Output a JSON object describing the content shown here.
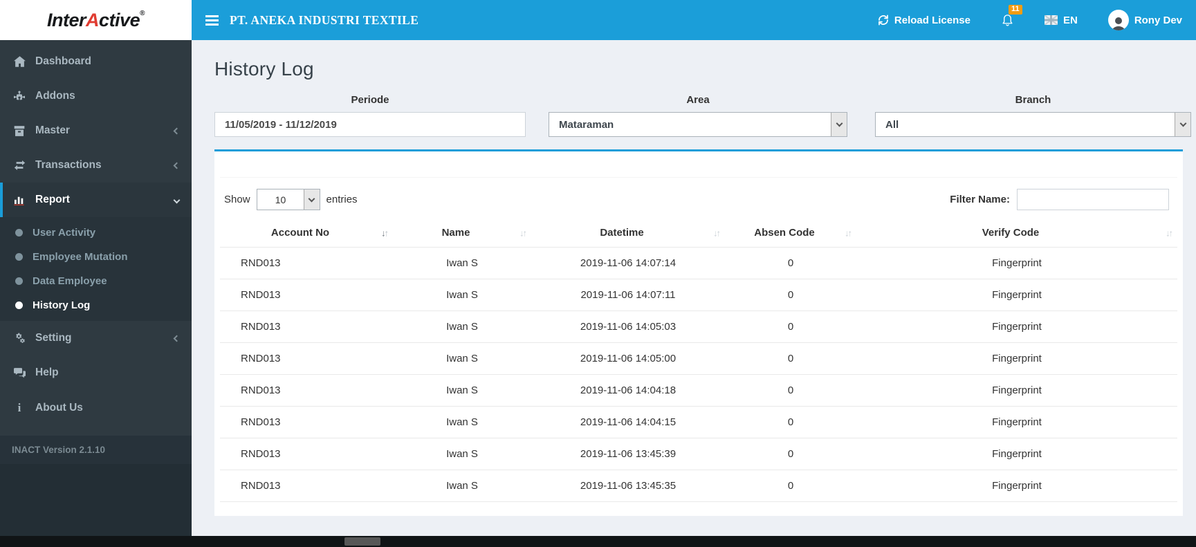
{
  "brand": {
    "part1": "Inter",
    "part2": "A",
    "part3": "ctive",
    "reg": "®"
  },
  "header": {
    "company": "PT. ANEKA INDUSTRI TEXTILE",
    "reload_label": "Reload License",
    "notification_count": "11",
    "language": "EN",
    "user_name": "Rony Dev"
  },
  "sidebar": {
    "items": [
      {
        "label": "Dashboard"
      },
      {
        "label": "Addons"
      },
      {
        "label": "Master"
      },
      {
        "label": "Transactions"
      },
      {
        "label": "Report"
      },
      {
        "label": "Setting"
      },
      {
        "label": "Help"
      },
      {
        "label": "About Us"
      }
    ],
    "submenu": [
      {
        "label": "User Activity"
      },
      {
        "label": "Employee Mutation"
      },
      {
        "label": "Data Employee"
      },
      {
        "label": "History Log"
      }
    ],
    "version": "INACT Version 2.1.10"
  },
  "page": {
    "title": "History Log"
  },
  "filters": {
    "periode": {
      "label": "Periode",
      "value": "11/05/2019 - 11/12/2019"
    },
    "area": {
      "label": "Area",
      "value": "Mataraman"
    },
    "branch": {
      "label": "Branch",
      "value": "All"
    }
  },
  "controls": {
    "show_label": "Show",
    "page_size": "10",
    "entries_label": "entries",
    "filter_label": "Filter Name:",
    "filter_value": ""
  },
  "table": {
    "columns": [
      "Account No",
      "Name",
      "Datetime",
      "Absen Code",
      "Verify Code"
    ],
    "rows": [
      [
        "RND013",
        "Iwan S",
        "2019-11-06 14:07:14",
        "0",
        "Fingerprint"
      ],
      [
        "RND013",
        "Iwan S",
        "2019-11-06 14:07:11",
        "0",
        "Fingerprint"
      ],
      [
        "RND013",
        "Iwan S",
        "2019-11-06 14:05:03",
        "0",
        "Fingerprint"
      ],
      [
        "RND013",
        "Iwan S",
        "2019-11-06 14:05:00",
        "0",
        "Fingerprint"
      ],
      [
        "RND013",
        "Iwan S",
        "2019-11-06 14:04:18",
        "0",
        "Fingerprint"
      ],
      [
        "RND013",
        "Iwan S",
        "2019-11-06 14:04:15",
        "0",
        "Fingerprint"
      ],
      [
        "RND013",
        "Iwan S",
        "2019-11-06 13:45:39",
        "0",
        "Fingerprint"
      ],
      [
        "RND013",
        "Iwan S",
        "2019-11-06 13:45:35",
        "0",
        "Fingerprint"
      ]
    ]
  },
  "icons": {
    "sort_down": "↓",
    "sort_up": "↑",
    "info": "i"
  },
  "colors": {
    "accent_blue": "#1A9DD9",
    "header_blue": "#1B9ED9",
    "badge_orange": "#F39C12",
    "sidebar_dark": "#2F3A41",
    "submenu_dark": "#28333A",
    "content_bg": "#EDF0F5",
    "logo_red": "#E03C31"
  }
}
